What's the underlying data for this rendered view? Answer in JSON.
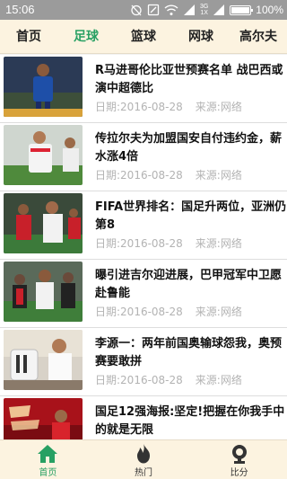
{
  "status_bar": {
    "time": "15:06",
    "network_top": "3G",
    "network_bottom": "1X",
    "battery": "100%"
  },
  "tabs": [
    {
      "label": "首页",
      "active": false
    },
    {
      "label": "足球",
      "active": true
    },
    {
      "label": "篮球",
      "active": false
    },
    {
      "label": "网球",
      "active": false
    },
    {
      "label": "高尔夫",
      "active": false
    }
  ],
  "news": [
    {
      "title": "R马进哥伦比亚世预赛名单 战巴西或演中超德比",
      "date": "日期:2016-08-28",
      "source": "来源:网络",
      "thumb": "blue-jersey-player"
    },
    {
      "title": "传拉尔夫为加盟国安自付违约金，薪水涨4倍",
      "date": "日期:2016-08-28",
      "source": "来源:网络",
      "thumb": "white-jersey-player"
    },
    {
      "title": "FIFA世界排名：国足升两位，亚洲仍第8",
      "date": "日期:2016-08-28",
      "source": "来源:网络",
      "thumb": "red-white-players"
    },
    {
      "title": "曝引进吉尔迎进展，巴甲冠军中卫愿赴鲁能",
      "date": "日期:2016-08-28",
      "source": "来源:网络",
      "thumb": "black-white-players"
    },
    {
      "title": "李源一：两年前国奥输球怨我，奥预赛要敢拼",
      "date": "日期:2016-08-28",
      "source": "来源:网络",
      "thumb": "player-with-trophy"
    },
    {
      "title": "国足12强海报:坚定!把握在你我手中的就是无限",
      "date": "",
      "source": "",
      "thumb": "red-poster"
    }
  ],
  "bottom_nav": [
    {
      "label": "首页",
      "icon": "home-icon",
      "active": true
    },
    {
      "label": "热门",
      "icon": "flame-icon",
      "active": false
    },
    {
      "label": "比分",
      "icon": "trophy-icon",
      "active": false
    }
  ],
  "colors": {
    "accent": "#27a063",
    "tab_bg": "#fcf3e0",
    "status_bg": "#9b9b9b",
    "meta_text": "#b3b3b3"
  }
}
